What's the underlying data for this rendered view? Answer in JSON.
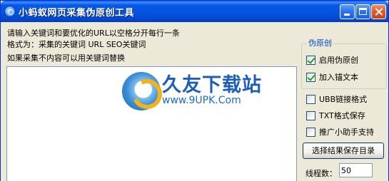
{
  "window": {
    "title": "小蚂蚁网页采集伪原创工具"
  },
  "instructions": {
    "line1": "请输入关键词和要优化的URL以空格分开每行一条",
    "line2": "格式为：采集的关键词 URL SEO关键词",
    "line3": "如果采集不内容可以用关键词替换"
  },
  "input_area": {
    "value": ""
  },
  "watermark": {
    "brand": "久友下载站",
    "url": "www.9UPK.Com"
  },
  "pseudo_original_group": {
    "title": "伪原创",
    "enable_label": "启用伪原创",
    "enable_checked": true,
    "anchor_label": "加入锚文本",
    "anchor_checked": true
  },
  "options": {
    "ubb_label": "UBB链接格式",
    "ubb_checked": false,
    "txt_label": "TXT格式保存",
    "txt_checked": false,
    "promo_label": "推广小助手支持",
    "promo_checked": false
  },
  "save_dir_button": "选择结果保存目录",
  "threads": {
    "label": "线程数：",
    "value": "50"
  },
  "colors": {
    "titlebar": "#0554e0",
    "groupbox_title": "#0046d5",
    "watermark": "#1b5fb8"
  }
}
